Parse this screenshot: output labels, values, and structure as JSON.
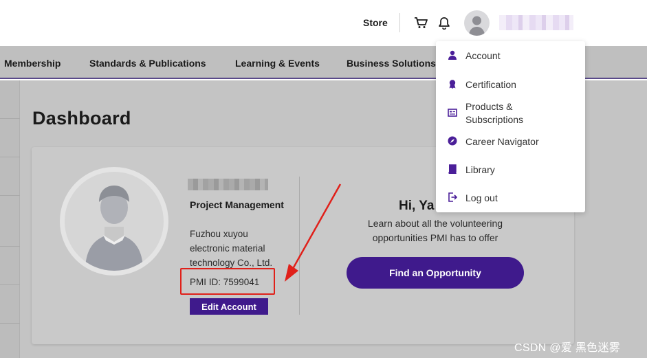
{
  "header": {
    "store_label": "Store",
    "icons": [
      "cart-icon",
      "bell-icon",
      "avatar"
    ]
  },
  "nav": {
    "items": [
      "Membership",
      "Standards & Publications",
      "Learning & Events",
      "Business Solutions"
    ]
  },
  "dashboard": {
    "title": "Dashboard",
    "profile": {
      "title": "Project Management",
      "organization": "Fuzhou xuyou electronic material technology Co., Ltd.",
      "pmi_id": "PMI ID: 7599041",
      "edit_label": "Edit Account"
    },
    "greeting": "Hi, Ya",
    "volunteer_text": "Learn about all the volunteering opportunities PMI has to offer",
    "find_label": "Find an Opportunity"
  },
  "account_menu": {
    "items": [
      {
        "label": "Account",
        "icon": "person-icon"
      },
      {
        "label": "Certification",
        "icon": "badge-icon"
      },
      {
        "label": "Products & Subscriptions",
        "icon": "products-icon"
      },
      {
        "label": "Career Navigator",
        "icon": "navigator-icon"
      },
      {
        "label": "Library",
        "icon": "book-icon"
      },
      {
        "label": "Log out",
        "icon": "logout-icon"
      }
    ]
  },
  "watermark": "CSDN @爱 黑色迷雾",
  "colors": {
    "brand_purple": "#3f1a8c",
    "icon_purple": "#4b1f99",
    "annotation_red": "#e0201a"
  }
}
